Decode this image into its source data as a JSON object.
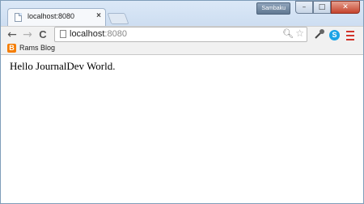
{
  "tab": {
    "title": "localhost:8080",
    "close": "×"
  },
  "window": {
    "user": "Sambaku",
    "min": "–",
    "max": "□",
    "close": "✕"
  },
  "toolbar": {
    "back": "←",
    "forward": "→",
    "reload": "C",
    "url_host": "localhost",
    "url_port": ":8080",
    "zoom": "🔍︎",
    "star": "☆",
    "skype": "S"
  },
  "bookmarks": {
    "items": [
      {
        "label": "Rams Blog",
        "icon": "blogger-icon",
        "icon_glyph": "B"
      }
    ]
  },
  "content": {
    "text": "Hello JournalDev World."
  },
  "colors": {
    "accent_menu": "#d2342b",
    "skype": "#1aa3e6",
    "blogger": "#f57d00"
  }
}
